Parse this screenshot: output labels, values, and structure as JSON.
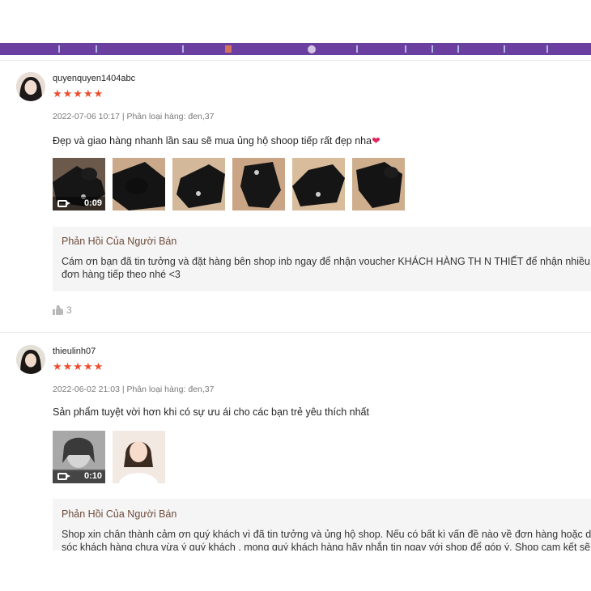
{
  "reviews": [
    {
      "username": "quyenquyen1404abc",
      "stars": "★★★★★",
      "rating": 5,
      "meta": "2022-07-06 10:17 | Phân loại hàng: đen,37",
      "comment": "Đẹp và giao hàng nhanh lần sau sẽ mua ủng hộ shoop tiếp rất đẹp nha",
      "comment_emoji": "❤",
      "video_duration": "0:09",
      "thumbnail_count": 6,
      "seller_title": "Phản Hồi Của Người Bán",
      "seller_line1": "Cám ơn bạn đã tin tưởng và đặt hàng bên shop inb ngay để nhận voucher KHÁCH HÀNG TH N THIẾT để nhận nhiều",
      "seller_line2": "đơn hàng tiếp theo nhé <3",
      "likes": "3"
    },
    {
      "username": "thieulinh07",
      "stars": "★★★★★",
      "rating": 5,
      "meta": "2022-06-02 21:03 | Phân loại hàng: đen,37",
      "comment": "Sản phẩm tuyệt vời hơn khi có sự ưu ái cho các bạn trẻ yêu thích nhất",
      "video_duration": "0:10",
      "thumbnail_count": 2,
      "seller_title": "Phản Hồi Của Người Bán",
      "seller_line1": "Shop xin chân thành cảm ơn quý khách vì đã tin tưởng và ủng hộ shop. Nếu có bất kì vấn đề nào về đơn hàng hoặc d",
      "seller_line2": "sóc khách hàng chưa vừa ý quý khách , mong quý khách hàng hãy nhắn tin ngay với shop để góp ý. Shop cam kết sẽ"
    }
  ],
  "colors": {
    "star": "#ee4d2d",
    "seller_title": "#6d4b3c",
    "topbar": "#6b3fa0"
  },
  "icons": [
    "video-camera-icon",
    "thumbs-up-icon",
    "heart-emoji-icon",
    "star-icon"
  ]
}
